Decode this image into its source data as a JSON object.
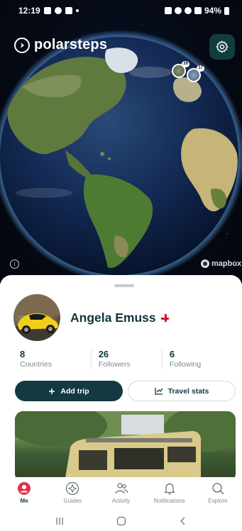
{
  "status_bar": {
    "time": "12:19",
    "battery": "94%"
  },
  "brand": {
    "name": "polarsteps"
  },
  "map": {
    "pins": [
      {
        "badge": "29"
      },
      {
        "badge": "17"
      }
    ],
    "attribution": "mapbox"
  },
  "profile": {
    "name": "Angela Emuss",
    "stats": [
      {
        "value": "8",
        "label": "Countries"
      },
      {
        "value": "26",
        "label": "Followers"
      },
      {
        "value": "6",
        "label": "Following"
      }
    ],
    "add_trip_label": "Add trip",
    "travel_stats_label": "Travel stats"
  },
  "nav": [
    {
      "label": "Me",
      "icon": "person-icon",
      "active": true
    },
    {
      "label": "Guides",
      "icon": "compass-badge-icon",
      "active": false
    },
    {
      "label": "Activity",
      "icon": "people-icon",
      "active": false
    },
    {
      "label": "Notifications",
      "icon": "bell-icon",
      "active": false
    },
    {
      "label": "Explore",
      "icon": "search-icon",
      "active": false
    }
  ],
  "colors": {
    "brand_dark": "#123a40",
    "accent_red": "#d0172d"
  }
}
